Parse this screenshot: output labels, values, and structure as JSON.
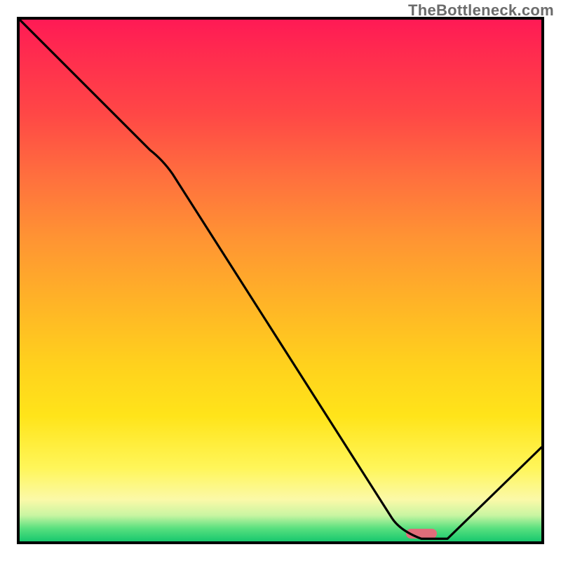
{
  "watermark": "TheBottleneck.com",
  "chart_data": {
    "type": "line",
    "title": "",
    "xlabel": "",
    "ylabel": "",
    "xlim": [
      0,
      100
    ],
    "ylim": [
      0,
      100
    ],
    "grid": false,
    "series": [
      {
        "name": "bottleneck-curve",
        "x": [
          0,
          25,
          73,
          77,
          82,
          100
        ],
        "values": [
          100,
          75,
          2,
          0.5,
          0.5,
          18
        ]
      }
    ],
    "optimum_marker": {
      "x_start": 74,
      "x_end": 80,
      "y": 1.5
    },
    "gradient_stops": [
      {
        "pos": 0,
        "color": "#ff1a55"
      },
      {
        "pos": 50,
        "color": "#ffb327"
      },
      {
        "pos": 85,
        "color": "#fff65a"
      },
      {
        "pos": 100,
        "color": "#18c86e"
      }
    ]
  }
}
